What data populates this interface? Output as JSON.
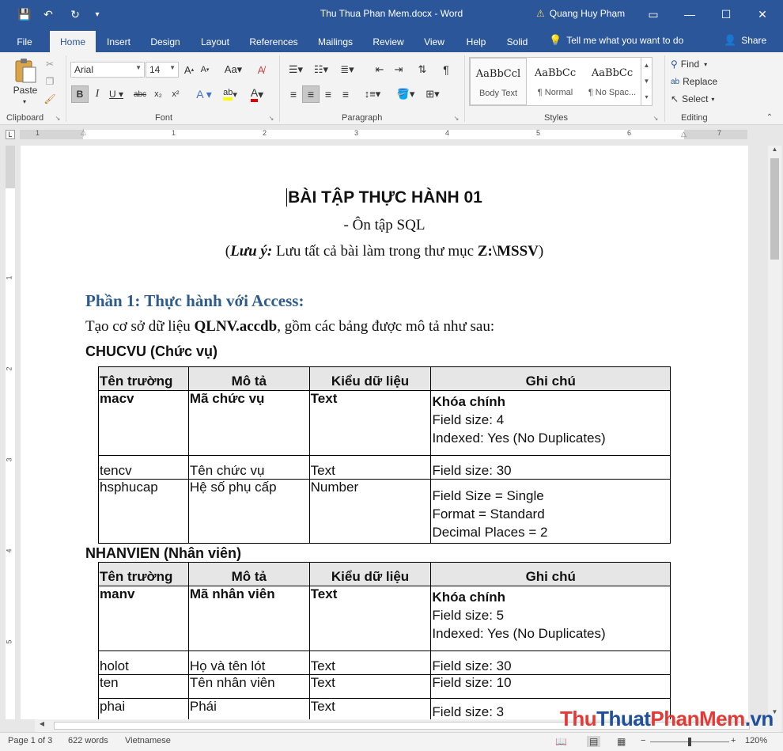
{
  "window": {
    "doc_title": "Thu Thua Phan Mem.docx - Word",
    "user": "Quang Huy Phạm",
    "minimize_glyph": "—",
    "restore_glyph": "☐",
    "close_glyph": "✕",
    "save_glyph": "💾",
    "undo_glyph": "↶",
    "redo_glyph": "↻",
    "qa_more_glyph": "▾",
    "ribbon_opts_glyph": "▭",
    "warn_glyph": "⚠"
  },
  "tabs": [
    {
      "label": "File"
    },
    {
      "label": "Home"
    },
    {
      "label": "Insert"
    },
    {
      "label": "Design"
    },
    {
      "label": "Layout"
    },
    {
      "label": "References"
    },
    {
      "label": "Mailings"
    },
    {
      "label": "Review"
    },
    {
      "label": "View"
    },
    {
      "label": "Help"
    },
    {
      "label": "Solid"
    }
  ],
  "tell_me": "Tell me what you want to do",
  "share": "Share",
  "ribbon": {
    "clipboard": {
      "paste": "Paste",
      "label": "Clipboard"
    },
    "font": {
      "name": "Arial",
      "size": "14",
      "label": "Font"
    },
    "paragraph": {
      "label": "Paragraph"
    },
    "styles": {
      "label": "Styles",
      "items": [
        {
          "sample": "AaBbCcl",
          "name": "Body Text"
        },
        {
          "sample": "AaBbCc",
          "name": "¶ Normal"
        },
        {
          "sample": "AaBbCc",
          "name": "¶ No Spac..."
        }
      ]
    },
    "editing": {
      "find": "Find",
      "replace": "Replace",
      "select": "Select",
      "label": "Editing"
    }
  },
  "document": {
    "title": "BÀI TẬP THỰC HÀNH 01",
    "subtitle": "- Ôn tập SQL",
    "note_prefix": "(",
    "note_label": "Lưu ý:",
    "note_text": " Lưu tất cả bài làm trong thư mục ",
    "note_path": "Z:\\MSSV",
    "note_suffix": ")",
    "part1_heading": "Phần 1: Thực hành với Access:",
    "intro_prefix": "Tạo cơ sở dữ liệu ",
    "intro_db": "QLNV.accdb",
    "intro_suffix": ", gồm các bảng được mô tả như sau:",
    "headers": [
      "Tên trường",
      "Mô tả",
      "Kiểu dữ liệu",
      "Ghi chú"
    ],
    "table1": {
      "caption": "CHUCVU (Chức vụ)",
      "rows": [
        {
          "field": "macv",
          "desc": "Mã chức vụ",
          "type": "Text",
          "notes": [
            "Khóa chính",
            "Field size: 4",
            "Indexed: Yes (No Duplicates)"
          ],
          "bold": true
        },
        {
          "field": "tencv",
          "desc": "Tên chức vụ",
          "type": "Text",
          "notes": [
            "Field size: 30"
          ],
          "bold": false
        },
        {
          "field": "hsphucap",
          "desc": "Hệ số phụ cấp",
          "type": "Number",
          "notes": [
            "Field Size = Single",
            "Format = Standard",
            "Decimal Places = 2"
          ],
          "bold": false
        }
      ]
    },
    "table2": {
      "caption": "NHANVIEN (Nhân viên)",
      "rows": [
        {
          "field": "manv",
          "desc": "Mã nhân viên",
          "type": "Text",
          "notes": [
            "Khóa chính",
            "Field size: 5",
            "Indexed: Yes (No Duplicates)"
          ],
          "bold": true
        },
        {
          "field": "holot",
          "desc": "Họ và tên lót",
          "type": "Text",
          "notes": [
            "Field size: 30"
          ],
          "bold": false
        },
        {
          "field": "ten",
          "desc": "Tên nhân viên",
          "type": "Text",
          "notes": [
            "Field size: 10"
          ],
          "bold": false
        },
        {
          "field": "phai",
          "desc": "Phái",
          "type": "Text",
          "notes": [
            "Field size: 3"
          ],
          "bold": false
        }
      ]
    }
  },
  "ruler_numbers": [
    "1",
    "1",
    "2",
    "3",
    "4",
    "5",
    "6",
    "7"
  ],
  "vruler_numbers": [
    "1",
    "2",
    "3",
    "4",
    "5"
  ],
  "status": {
    "page": "Page 1 of 3",
    "words": "622 words",
    "language": "Vietnamese",
    "zoom": "120%"
  },
  "watermark": {
    "part1": "Thu",
    "part2": "Thuat",
    "part3": "PhanMem",
    "part4": ".vn"
  },
  "colors": {
    "title_bar": "#2b579a",
    "heading": "#2e5b8e"
  }
}
